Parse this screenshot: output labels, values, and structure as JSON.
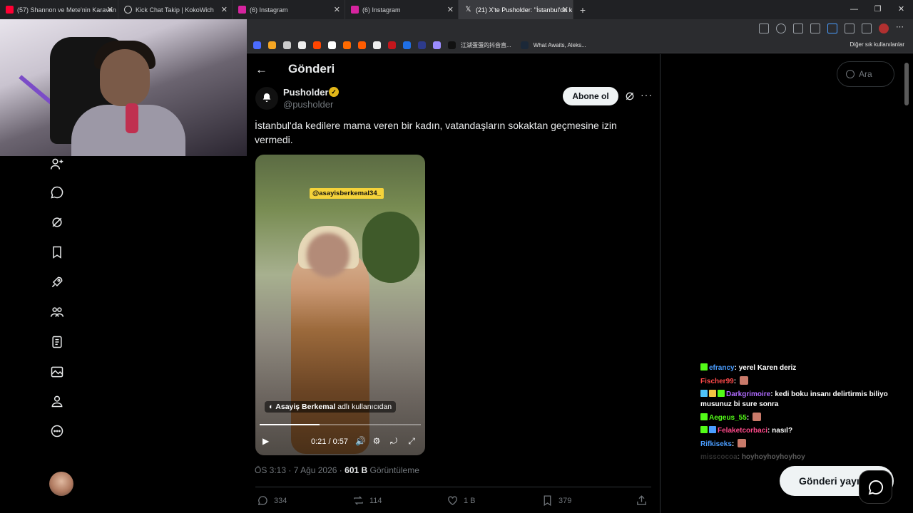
{
  "browser": {
    "tabs": [
      {
        "title": "(57) Shannon ve Mete'nin Karavan",
        "color": "#ff0033"
      },
      {
        "title": "Kick Chat Takip | KokoWich",
        "color": "#cccccc"
      },
      {
        "title": "(6) Instagram",
        "color": "#d6249f"
      },
      {
        "title": "(6) Instagram",
        "color": "#d6249f"
      },
      {
        "title": "(21) X'te Pusholder: \"İstanbul'da k",
        "color": "#ffffff"
      }
    ],
    "tab_close": "✕",
    "new_tab": "+",
    "window_controls": [
      "—",
      "❐",
      "✕"
    ],
    "bookmarks": [
      {
        "label": "",
        "color": "#4b6cff"
      },
      {
        "label": "",
        "color": "#f5a623"
      },
      {
        "label": "",
        "color": "#cccccc"
      },
      {
        "label": "",
        "color": "#eeeeee"
      },
      {
        "label": "",
        "color": "#ff4500"
      },
      {
        "label": "",
        "color": "#ffffff"
      },
      {
        "label": "",
        "color": "#ff6a00"
      },
      {
        "label": "",
        "color": "#ff5c00"
      },
      {
        "label": "",
        "color": "#eeeeee"
      },
      {
        "label": "",
        "color": "#c4161c"
      },
      {
        "label": "",
        "color": "#1f6fe5"
      },
      {
        "label": "",
        "color": "#2d3b8c"
      },
      {
        "label": "",
        "color": "#9b8cff"
      },
      {
        "label": "江湖蛋蛋的抖音直...",
        "color": "#111111"
      },
      {
        "label": "What Awaits, Aleks...",
        "color": "#1b2838"
      }
    ],
    "bookmarks_other": "Diğer sık kullanılanlar"
  },
  "sidebar": {
    "items": [
      {
        "name": "follow",
        "icon": "add-person-icon"
      },
      {
        "name": "messages",
        "icon": "chat-bubble-icon"
      },
      {
        "name": "grok",
        "icon": "grok-icon"
      },
      {
        "name": "bookmarks",
        "icon": "bookmark-icon"
      },
      {
        "name": "jobs",
        "icon": "rocket-icon"
      },
      {
        "name": "communities",
        "icon": "people-icon"
      },
      {
        "name": "articles",
        "icon": "document-icon"
      },
      {
        "name": "media",
        "icon": "image-icon"
      },
      {
        "name": "profile",
        "icon": "person-icon"
      },
      {
        "name": "more",
        "icon": "more-circle-icon"
      }
    ]
  },
  "post": {
    "header_title": "Gönderi",
    "back_glyph": "←",
    "author_name": "Pusholder",
    "author_handle": "@pusholder",
    "verified_glyph": "✓",
    "subscribe_label": "Abone ol",
    "more_glyph": "···",
    "text": "İstanbul'da kedilere mama veren bir kadın, vatandaşların sokaktan geçmesine izin vermedi.",
    "video": {
      "tag": "@asayisberkemal34_",
      "credit_user": "Asayiş Berkemal",
      "credit_suffix": "adlı kullanıcıdan",
      "progress": 0.37,
      "timecode": "0:21 / 0:57",
      "play_glyph": "▶",
      "controls": [
        "🔊",
        "⚙",
        "⤾",
        "⤢"
      ]
    },
    "time": "ÖS 3:13",
    "date": "7 Ağu 2026",
    "separator": "·",
    "views_count": "601 B",
    "views_label": "Görüntüleme",
    "actions": {
      "replies": "334",
      "reposts": "114",
      "likes": "1 B",
      "bookmarks": "379"
    }
  },
  "right": {
    "search_placeholder": "Ara",
    "post_button": "Gönderi yayı"
  },
  "chat": [
    {
      "user": "efrancy",
      "color": "#4a9dff",
      "message": "yerel Karen deriz"
    },
    {
      "user": "Fischer99",
      "color": "#ff4a4a",
      "message": ""
    },
    {
      "user": "Darkgrimoire",
      "color": "#b06bff",
      "message": "kedi boku insanı delirtirmis biliyo musunuz bi sure sonra"
    },
    {
      "user": "Aegeus_55",
      "color": "#4fc3f7",
      "message": ""
    },
    {
      "user": "Felaketcorbaci",
      "color": "#ff4a8a",
      "message": "nasıl?"
    },
    {
      "user": "Rifkiseks",
      "color": "#4a9dff",
      "message": ""
    },
    {
      "user": "misscocoa",
      "color": "#888888",
      "message": "hoyhoyhoyhoyhoy"
    }
  ],
  "separator_colon": ":"
}
